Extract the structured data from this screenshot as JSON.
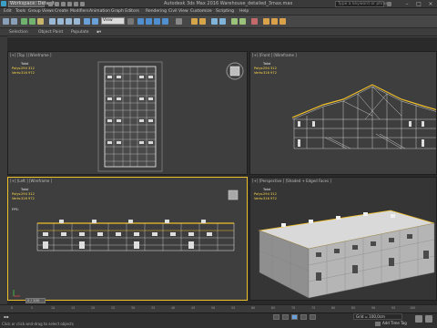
{
  "titlebar": {
    "workspace_label": "Workspace: Default",
    "title": "Autodesk 3ds Max 2016     Warehouse_detailed_3max.max",
    "search_placeholder": "Type a keyword or phrase"
  },
  "menus": [
    "Edit",
    "Tools",
    "Group",
    "Views",
    "Create",
    "Modifiers",
    "Animation",
    "Graph Editors",
    "Rendering",
    "Civil View",
    "Customize",
    "Scripting",
    "Help"
  ],
  "toolbar": {
    "selection_filter": "View"
  },
  "ribbon": {
    "tabs": [
      "Selection",
      "Object Paint",
      "Populate"
    ]
  },
  "viewports": {
    "top": {
      "label": "[+] [Top ] [Wireframe ]"
    },
    "front": {
      "label": "[+] [Front ] [Wireframe ]"
    },
    "left": {
      "label": "[+] [Left ] [Wireframe ]",
      "fps": "FPS:"
    },
    "perspective": {
      "label": "[+] [Perspective ] [Shaded + Edged Faces ]"
    },
    "stats": {
      "total": "Total",
      "polys": "Polys:",
      "polys_value": "294 312",
      "verts": "Verts:",
      "verts_value": "316 972"
    }
  },
  "timeline": {
    "slider": "0 / 100",
    "ticks": [
      "0",
      "5",
      "10",
      "15",
      "20",
      "25",
      "30",
      "35",
      "40",
      "45",
      "50",
      "55",
      "60",
      "65",
      "70",
      "75",
      "80",
      "85",
      "90",
      "95",
      "100"
    ]
  },
  "status": {
    "prompt": "Click or click-and-drag to select objects",
    "grid": "Grid = 100,0cm",
    "add_time_tag": "Add Time Tag"
  },
  "colors": {
    "selection_yellow": "#f0c02a",
    "stat_yellow": "#ffd84a",
    "viewport_bg": "#3e3e3e"
  }
}
